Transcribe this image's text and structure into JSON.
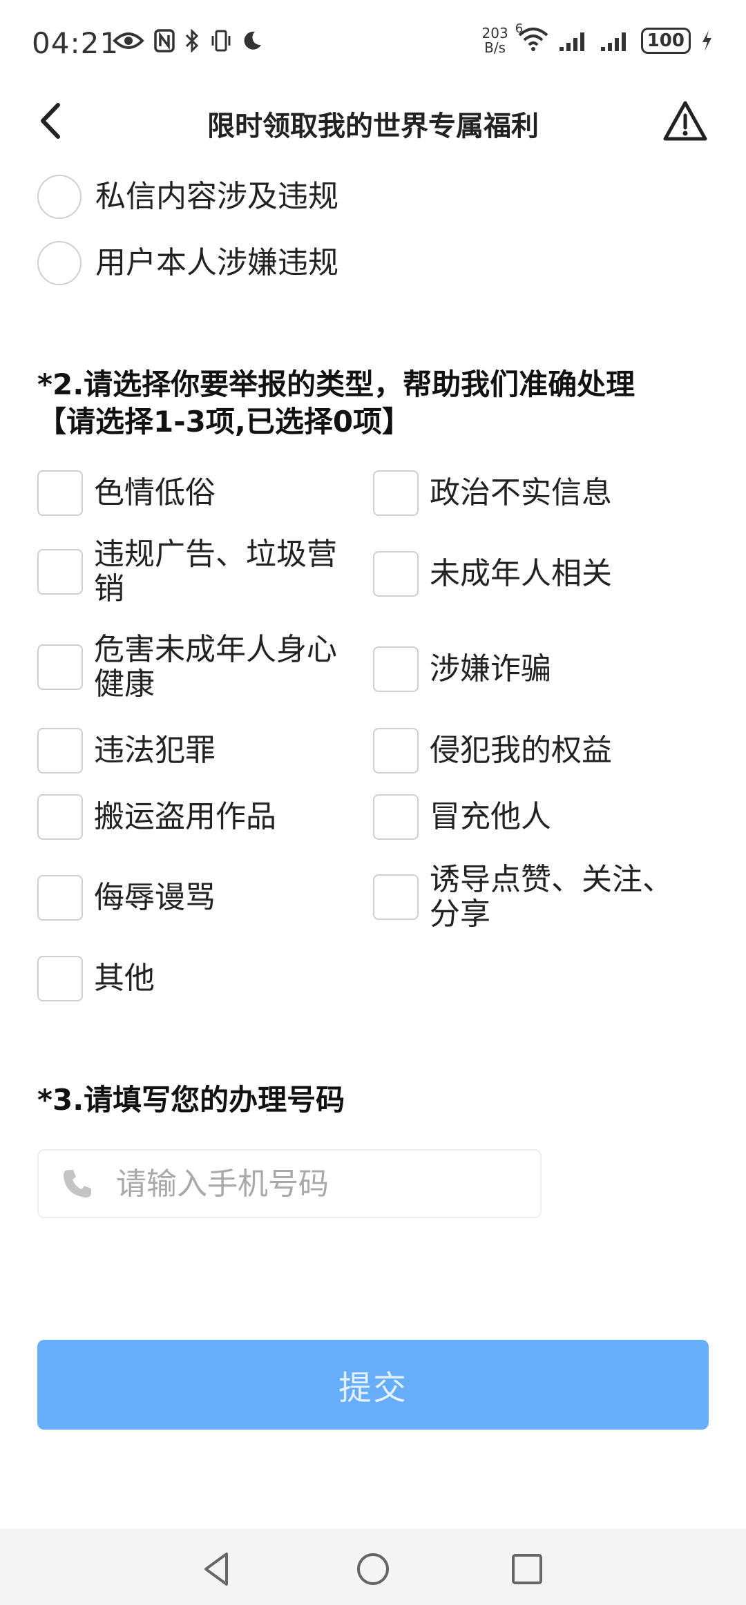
{
  "status_bar": {
    "time": "04:21",
    "net_speed_value": "203",
    "net_speed_unit": "B/s",
    "wifi_badge": "6",
    "battery": "100",
    "icons": [
      "eye-icon",
      "nfc-icon",
      "bluetooth-icon",
      "vibrate-icon",
      "moon-icon",
      "wifi-icon",
      "signal-icon",
      "signal-icon",
      "battery-icon",
      "charging-icon"
    ]
  },
  "header": {
    "title": "限时领取我的世界专属福利",
    "back_icon": "back-arrow-icon",
    "report_icon": "warning-icon"
  },
  "question1": {
    "options": [
      {
        "label": "私信内容涉及违规",
        "selected": false
      },
      {
        "label": "用户本人涉嫌违规",
        "selected": false
      }
    ]
  },
  "question2": {
    "title_line1": "*2.请选择你要举报的类型，帮助我们准确处理",
    "title_line2": "【请选择1-3项,已选择0项】",
    "options": [
      {
        "label": "色情低俗",
        "checked": false
      },
      {
        "label": "政治不实信息",
        "checked": false
      },
      {
        "label": "违规广告、垃圾营销",
        "checked": false
      },
      {
        "label": "未成年人相关",
        "checked": false
      },
      {
        "label": "危害未成年人身心健康",
        "checked": false
      },
      {
        "label": "涉嫌诈骗",
        "checked": false
      },
      {
        "label": "违法犯罪",
        "checked": false
      },
      {
        "label": "侵犯我的权益",
        "checked": false
      },
      {
        "label": "搬运盗用作品",
        "checked": false
      },
      {
        "label": "冒充他人",
        "checked": false
      },
      {
        "label": "侮辱谩骂",
        "checked": false
      },
      {
        "label": "诱导点赞、关注、分享",
        "checked": false
      },
      {
        "label": "其他",
        "checked": false
      }
    ]
  },
  "question3": {
    "title": "*3.请填写您的办理号码",
    "input_placeholder": "请输入手机号码",
    "input_value": "",
    "input_icon": "phone-icon"
  },
  "submit_label": "提交",
  "colors": {
    "submit_bg": "#66adfa",
    "submit_text": "#e5f1ff",
    "border": "#cfcfcf"
  },
  "nav_bar": {
    "buttons": [
      "back-triangle-icon",
      "home-circle-icon",
      "recents-square-icon"
    ]
  }
}
